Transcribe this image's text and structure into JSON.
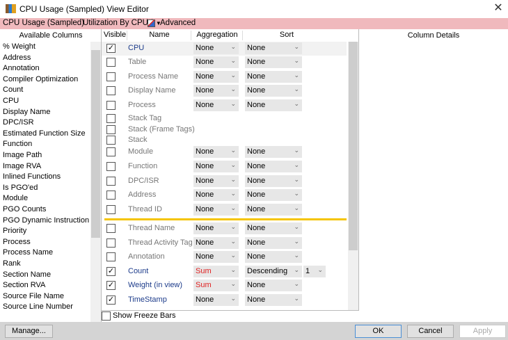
{
  "window": {
    "title": "CPU Usage (Sampled) View Editor"
  },
  "toolbar": {
    "graph": "CPU Usage (Sampled)",
    "preset": "Utilization By CPU *",
    "advanced": "Advanced"
  },
  "available_columns": {
    "header": "Available Columns",
    "items": [
      "% Weight",
      "Address",
      "Annotation",
      "Compiler Optimization",
      "Count",
      "CPU",
      "Display Name",
      "DPC/ISR",
      "Estimated Function Size",
      "Function",
      "Image Path",
      "Image RVA",
      "Inlined Functions",
      "Is PGO'ed",
      "Module",
      "PGO Counts",
      "PGO Dynamic Instruction Count",
      "Priority",
      "Process",
      "Process Name",
      "Rank",
      "Section Name",
      "Section RVA",
      "Source File Name",
      "Source Line Number"
    ]
  },
  "grid": {
    "headers": {
      "visible": "Visible",
      "name": "Name",
      "aggregation": "Aggregation",
      "sort": "Sort"
    },
    "rows": [
      {
        "name": "CPU",
        "visible": true,
        "aggregation": "None",
        "sort": "None"
      },
      {
        "name": "Table",
        "visible": false,
        "aggregation": "None",
        "sort": "None"
      },
      {
        "name": "Process Name",
        "visible": false,
        "aggregation": "None",
        "sort": "None"
      },
      {
        "name": "Display Name",
        "visible": false,
        "aggregation": "None",
        "sort": "None"
      },
      {
        "name": "Process",
        "visible": false,
        "aggregation": "None",
        "sort": "None"
      },
      {
        "name": "Stack Tag",
        "visible": false
      },
      {
        "name": "Stack (Frame Tags)",
        "visible": false
      },
      {
        "name": "Stack",
        "visible": false
      },
      {
        "name": "Module",
        "visible": false,
        "aggregation": "None",
        "sort": "None"
      },
      {
        "name": "Function",
        "visible": false,
        "aggregation": "None",
        "sort": "None"
      },
      {
        "name": "DPC/ISR",
        "visible": false,
        "aggregation": "None",
        "sort": "None"
      },
      {
        "name": "Address",
        "visible": false,
        "aggregation": "None",
        "sort": "None"
      },
      {
        "name": "Thread ID",
        "visible": false,
        "aggregation": "None",
        "sort": "None"
      },
      {
        "name": "Thread Name",
        "visible": false,
        "aggregation": "None",
        "sort": "None"
      },
      {
        "name": "Thread Activity Tag",
        "visible": false,
        "aggregation": "None",
        "sort": "None"
      },
      {
        "name": "Annotation",
        "visible": false,
        "aggregation": "None",
        "sort": "None"
      },
      {
        "name": "Count",
        "visible": true,
        "aggregation": "Sum",
        "sort": "Descending",
        "priority": "1"
      },
      {
        "name": "Weight (in view)",
        "visible": true,
        "aggregation": "Sum",
        "sort": "None"
      },
      {
        "name": "TimeStamp",
        "visible": true,
        "aggregation": "None",
        "sort": "None"
      }
    ]
  },
  "details": {
    "header": "Column Details"
  },
  "freeze": {
    "label": "Show Freeze Bars"
  },
  "buttons": {
    "manage": "Manage...",
    "ok": "OK",
    "cancel": "Cancel",
    "apply": "Apply"
  },
  "colors": {
    "toolbar": "#f0b9bd",
    "freeze_line": "#f5c400",
    "sum": "#e02020"
  }
}
